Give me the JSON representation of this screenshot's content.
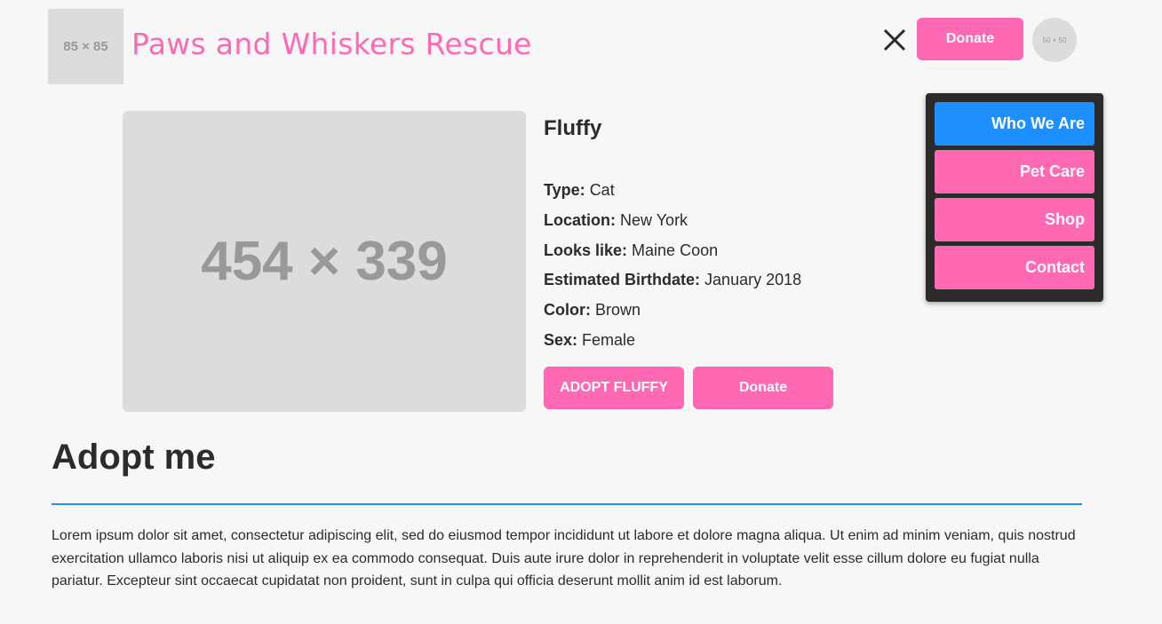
{
  "header": {
    "logo_placeholder": "85 × 85",
    "site_title": "Paws and Whiskers Rescue",
    "close_icon": "close-icon",
    "donate_label": "Donate",
    "avatar_placeholder": "50 × 50"
  },
  "menu": {
    "items": [
      {
        "label": "Who We Are",
        "active": true
      },
      {
        "label": "Pet Care",
        "active": false
      },
      {
        "label": "Shop",
        "active": false
      },
      {
        "label": "Contact",
        "active": false
      }
    ]
  },
  "pet": {
    "image_placeholder": "454 × 339",
    "name": "Fluffy",
    "facts": [
      {
        "label": "Type:",
        "value": "Cat"
      },
      {
        "label": "Location:",
        "value": "New York"
      },
      {
        "label": "Looks like:",
        "value": "Maine Coon"
      },
      {
        "label": "Estimated Birthdate:",
        "value": "January 2018"
      },
      {
        "label": "Color:",
        "value": "Brown"
      },
      {
        "label": "Sex:",
        "value": "Female"
      }
    ],
    "adopt_label": "ADOPT FLUFFY",
    "donate_label": "Donate"
  },
  "section": {
    "title": "Adopt me",
    "body": "Lorem ipsum dolor sit amet, consectetur adipiscing elit, sed do eiusmod tempor incididunt ut labore et dolore magna aliqua. Ut enim ad minim veniam, quis nostrud exercitation ullamco laboris nisi ut aliquip ex ea commodo consequat. Duis aute irure dolor in reprehenderit in voluptate velit esse cillum dolore eu fugiat nulla pariatur. Excepteur sint occaecat cupidatat non proident, sunt in culpa qui officia deserunt mollit anim id est laborum."
  },
  "colors": {
    "accent_pink": "#ff69b4",
    "accent_blue": "#1e8fff",
    "menu_background": "#2b2b2b",
    "page_background": "#f7f7f7"
  }
}
